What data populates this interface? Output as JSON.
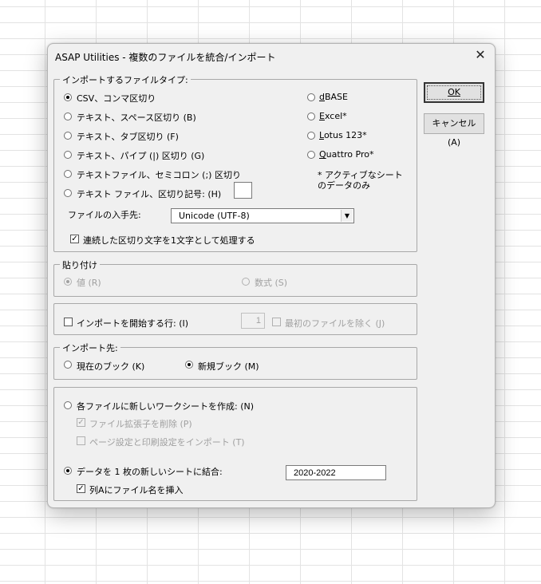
{
  "window": {
    "title": "ASAP Utilities - 複数のファイルを統合/インポート",
    "close_glyph": "✕"
  },
  "buttons": {
    "ok_label": "OK",
    "cancel_label": "キャンセル (A)"
  },
  "filetype_group": {
    "legend": "インポートするファイルタイプ:",
    "options_left": [
      {
        "label": "CSV、コンマ区切り",
        "selected": true
      },
      {
        "label": "テキスト、スペース区切り (B)",
        "selected": false
      },
      {
        "label": "テキスト、タブ区切り (F)",
        "selected": false
      },
      {
        "label": "テキスト、パイプ (|) 区切り (G)",
        "selected": false
      },
      {
        "label": "テキストファイル、セミコロン (;) 区切り",
        "selected": false
      },
      {
        "label": "テキスト ファイル、区切り記号:  (H)",
        "selected": false
      }
    ],
    "options_right": [
      {
        "prefix": "d",
        "rest": "BASE",
        "selected": false
      },
      {
        "prefix": "E",
        "rest": "xcel*",
        "selected": false
      },
      {
        "prefix": "L",
        "rest": "otus 123*",
        "selected": false
      },
      {
        "prefix": "Q",
        "rest": "uattro Pro*",
        "selected": false
      }
    ],
    "note": "* アクティブなシートのデータのみ",
    "delimiter_value": "",
    "encoding_label": "ファイルの入手先:",
    "encoding_value": "Unicode (UTF-8)",
    "consecutive_label": "連続した区切り文字を1文字として処理する",
    "consecutive_checked": true
  },
  "paste_group": {
    "legend": "貼り付け",
    "values_label": "値 (R)",
    "formats_label": "数式 (S)"
  },
  "start_row": {
    "label": "インポートを開始する行:  (I)",
    "checked": false,
    "value": "1",
    "exclude_label": "最初のファイルを除く (J)"
  },
  "destination_group": {
    "legend": "インポート先:",
    "current_label": "現在のブック (K)",
    "new_label": "新規ブック (M)",
    "selected": "new"
  },
  "sheet_options": {
    "new_sheet_label": "各ファイルに新しいワークシートを作成:  (N)",
    "remove_ext_label": "ファイル拡張子を削除 (P)",
    "import_page_setup_label": "ページ設定と印刷設定をインポート (T)",
    "combine_label": "データを 1 枚の新しいシートに結合:",
    "combine_selected": true,
    "sheet_name_value": "2020-2022",
    "insert_filename_label": "列Aにファイル名を挿入",
    "insert_filename_checked": true
  }
}
